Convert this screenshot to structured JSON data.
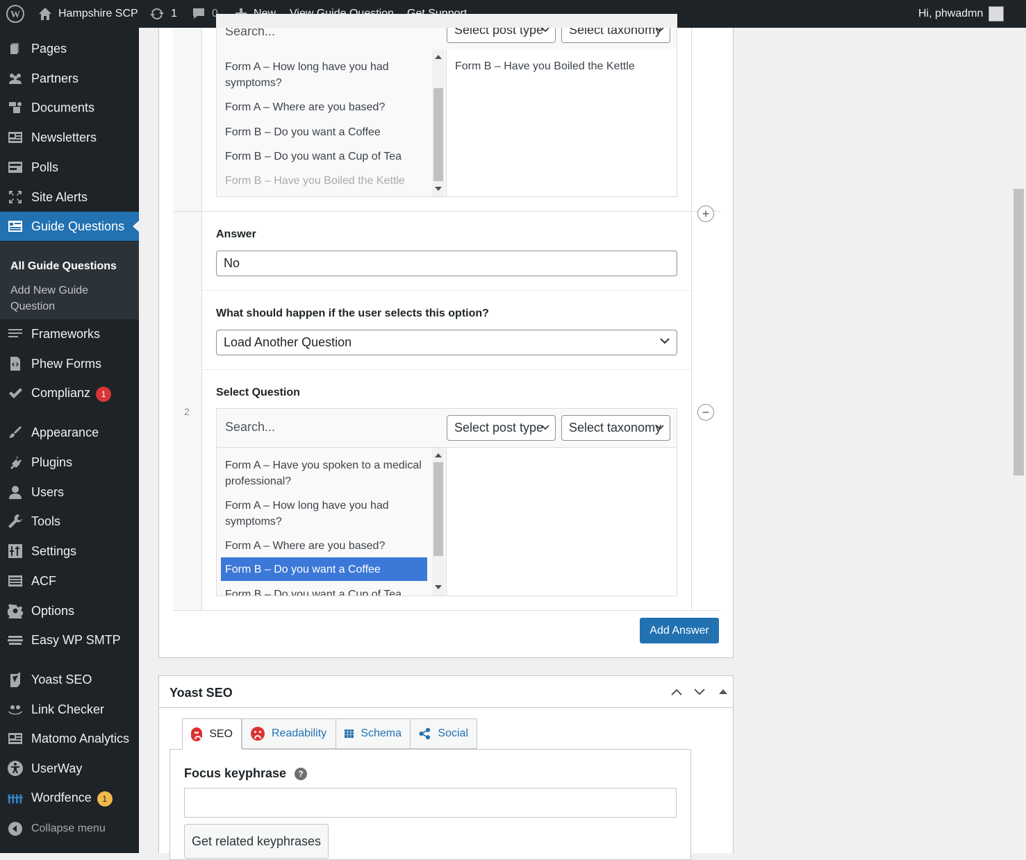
{
  "admin_bar": {
    "site_name": "Hampshire SCP",
    "updates_count": "1",
    "comments_count": "0",
    "new_label": "New",
    "view_label": "View Guide Question",
    "support_label": "Get Support",
    "greeting": "Hi, phwadmn"
  },
  "sidebar": {
    "items": [
      {
        "label": "Pages",
        "icon": "pages-icon"
      },
      {
        "label": "Partners",
        "icon": "partners-icon"
      },
      {
        "label": "Documents",
        "icon": "documents-icon"
      },
      {
        "label": "Newsletters",
        "icon": "newsletters-icon"
      },
      {
        "label": "Polls",
        "icon": "polls-icon"
      },
      {
        "label": "Site Alerts",
        "icon": "site-alerts-icon"
      },
      {
        "label": "Guide Questions",
        "icon": "guide-questions-icon"
      },
      {
        "label": "Frameworks",
        "icon": "frameworks-icon"
      },
      {
        "label": "Phew Forms",
        "icon": "phew-forms-icon"
      },
      {
        "label": "Complianz",
        "icon": "complianz-icon",
        "badge": "1"
      },
      {
        "label": "Appearance",
        "icon": "appearance-icon"
      },
      {
        "label": "Plugins",
        "icon": "plugins-icon"
      },
      {
        "label": "Users",
        "icon": "users-icon"
      },
      {
        "label": "Tools",
        "icon": "tools-icon"
      },
      {
        "label": "Settings",
        "icon": "settings-icon"
      },
      {
        "label": "ACF",
        "icon": "acf-icon"
      },
      {
        "label": "Options",
        "icon": "options-icon"
      },
      {
        "label": "Easy WP SMTP",
        "icon": "smtp-icon"
      },
      {
        "label": "Yoast SEO",
        "icon": "yoast-icon"
      },
      {
        "label": "Link Checker",
        "icon": "link-checker-icon"
      },
      {
        "label": "Matomo Analytics",
        "icon": "matomo-icon"
      },
      {
        "label": "UserWay",
        "icon": "userway-icon"
      },
      {
        "label": "Wordfence",
        "icon": "wordfence-icon",
        "badge": "1"
      }
    ],
    "submenu": {
      "all": "All Guide Questions",
      "add_new": "Add New Guide Question"
    },
    "collapse_label": "Collapse menu"
  },
  "row1": {
    "search_placeholder": "Search...",
    "post_type_select": "Select post type",
    "taxonomy_select": "Select taxonomy",
    "choices": [
      "Form A – How long have you had symptoms?",
      "Form A – Where are you based?",
      "Form B – Do you want a Coffee",
      "Form B – Do you want a Cup of Tea",
      "Form B – Have you Boiled the Kettle"
    ],
    "selected_values": [
      "Form B – Have you Boiled the Kettle"
    ]
  },
  "row2": {
    "row_number": "2",
    "answer_label": "Answer",
    "answer_value": "No",
    "action_label": "What should happen if the user selects this option?",
    "action_value": "Load Another Question",
    "select_question_label": "Select Question",
    "search_placeholder": "Search...",
    "post_type_select": "Select post type",
    "taxonomy_select": "Select taxonomy",
    "choices": [
      "Form A – Have you spoken to a medical professional?",
      "Form A – How long have you had symptoms?",
      "Form A – Where are you based?",
      "Form B – Do you want a Coffee",
      "Form B – Do you want a Cup of Tea"
    ]
  },
  "add_answer_label": "Add Answer",
  "yoast": {
    "title": "Yoast SEO",
    "tabs": [
      "SEO",
      "Readability",
      "Schema",
      "Social"
    ],
    "focus_label": "Focus keyphrase",
    "focus_value": "",
    "related_button": "Get related keyphrases"
  },
  "colors": {
    "accent": "#2271b1",
    "admin_bg": "#1d2327",
    "selected_choice": "#3c78d8",
    "badge_red": "#d63638",
    "badge_orange": "#f0b849",
    "sad_face": "#dc3232"
  }
}
